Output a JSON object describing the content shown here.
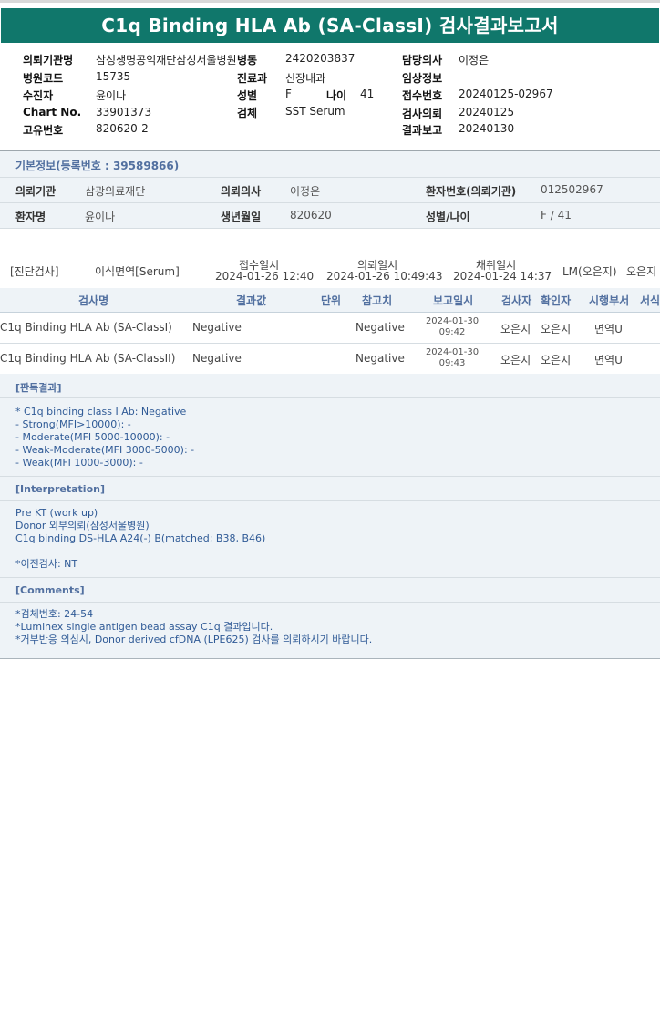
{
  "title": "C1q Binding HLA Ab (SA-ClassI) 검사결과보고서",
  "report_header": {
    "col1": [
      {
        "label": "의뢰기관명",
        "value": "삼성생명공익재단삼성서울병원"
      },
      {
        "label": "병원코드",
        "value": "15735"
      },
      {
        "label": "수진자",
        "value": "윤이나"
      },
      {
        "label": "Chart No.",
        "value": "33901373"
      },
      {
        "label": "고유번호",
        "value": "820620-2"
      }
    ],
    "col2": [
      {
        "label": "병동",
        "value": "2420203837"
      },
      {
        "label": "진료과",
        "value": "신장내과"
      },
      {
        "label": "성별",
        "value": "F"
      },
      {
        "label": "검체",
        "value": "SST Serum"
      }
    ],
    "age_label": "나이",
    "age_value": "41",
    "col3": [
      {
        "label": "담당의사",
        "value": "이정은"
      },
      {
        "label": "임상정보",
        "value": ""
      },
      {
        "label": "접수번호",
        "value": "20240125-02967"
      },
      {
        "label": "검사의뢰",
        "value": "20240125"
      },
      {
        "label": "결과보고",
        "value": "20240130"
      }
    ]
  },
  "patient_info": {
    "header": "기본정보(등록번호 : 39589866)",
    "rows": [
      [
        {
          "label": "의뢰기관",
          "value": "삼광의료재단"
        },
        {
          "label": "의뢰의사",
          "value": "이정은"
        },
        {
          "label": "환자번호(의뢰기관)",
          "value": "012502967"
        }
      ],
      [
        {
          "label": "환자명",
          "value": "윤이나"
        },
        {
          "label": "생년월일",
          "value": "820620"
        },
        {
          "label": "성별/나이",
          "value": "F / 41"
        }
      ]
    ]
  },
  "exam_info": {
    "category": "[진단검사]",
    "name": "이식면역[Serum]",
    "received_label": "접수일시",
    "received_value": "2024-01-26 12:40",
    "requested_label": "의뢰일시",
    "requested_value": "2024-01-26 10:49:43",
    "collected_label": "채취일시",
    "collected_value": "2024-01-24 14:37",
    "lm": "LM(오은지)",
    "tester": "오은지"
  },
  "table": {
    "headers": [
      "검사명",
      "결과값",
      "단위",
      "참고치",
      "보고일시",
      "검사자",
      "확인자",
      "시행부서",
      "서식"
    ],
    "rows": [
      {
        "name": "C1q Binding HLA Ab (SA-ClassI)",
        "result": "Negative",
        "unit": "",
        "reference": "Negative",
        "report_date": "2024-01-30",
        "report_time": "09:42",
        "tester": "오은지",
        "verifier": "오은지",
        "dept": "면역U"
      },
      {
        "name": "C1q Binding HLA Ab (SA-ClassII)",
        "result": "Negative",
        "unit": "",
        "reference": "Negative",
        "report_date": "2024-01-30",
        "report_time": "09:43",
        "tester": "오은지",
        "verifier": "오은지",
        "dept": "면역U"
      }
    ]
  },
  "sections": {
    "judgment_title": "[판독결과]",
    "judgment_text": "* C1q binding class I Ab: Negative\n- Strong(MFI>10000): -\n- Moderate(MFI 5000-10000): -\n- Weak-Moderate(MFI 3000-5000): -\n- Weak(MFI 1000-3000): -",
    "interpretation_title": "[Interpretation]",
    "interpretation_text": "Pre KT (work up)\nDonor 외부의뢰(삼성서울병원)\nC1q binding DS-HLA A24(-) B(matched; B38, B46)\n\n*이전검사: NT",
    "comments_title": "[Comments]",
    "comments_text": "*검체번호: 24-54\n*Luminex single antigen bead assay C1q 결과입니다.\n*거부반응 의심시, Donor derived cfDNA (LPE625) 검사를 의뢰하시기 바랍니다."
  },
  "colors": {
    "title_bar": "#10776b",
    "label_blue": "#5270a0",
    "note_text": "#2f5a96",
    "panel_bg": "#eef3f7"
  }
}
